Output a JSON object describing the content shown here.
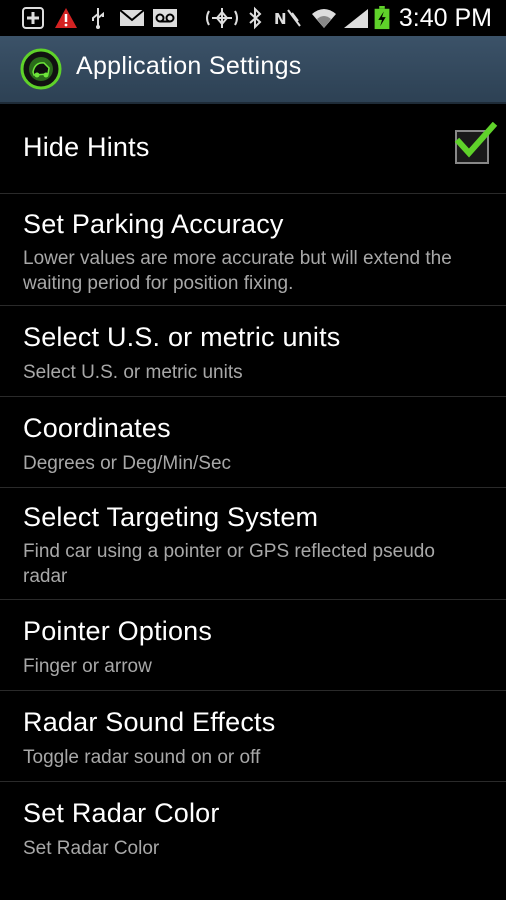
{
  "status_bar": {
    "time": "3:40 PM",
    "icons": [
      "add-icon",
      "alert-icon",
      "usb-icon",
      "mail-icon",
      "voicemail-icon",
      "gps-icon",
      "bluetooth-icon",
      "nfc-icon",
      "wifi-icon",
      "signal-icon",
      "battery-charging-icon"
    ]
  },
  "action_bar": {
    "title": "Application Settings",
    "icon": "app-logo-icon"
  },
  "settings": [
    {
      "title": "Hide Hints",
      "subtitle": "",
      "checked": true
    },
    {
      "title": "Set Parking Accuracy",
      "subtitle": "Lower values are more accurate but will extend the waiting period for position fixing."
    },
    {
      "title": "Select U.S. or metric units",
      "subtitle": "Select U.S. or metric units"
    },
    {
      "title": "Coordinates",
      "subtitle": "Degrees or Deg/Min/Sec"
    },
    {
      "title": "Select Targeting System",
      "subtitle": "Find car using a pointer or GPS reflected pseudo radar"
    },
    {
      "title": "Pointer Options",
      "subtitle": "Finger or arrow"
    },
    {
      "title": "Radar Sound Effects",
      "subtitle": "Toggle radar sound on or off"
    },
    {
      "title": "Set Radar Color",
      "subtitle": "Set Radar Color"
    }
  ],
  "colors": {
    "action_bar": "#34495d",
    "check": "#5fd22a",
    "subtitle": "#a8a8a8"
  }
}
